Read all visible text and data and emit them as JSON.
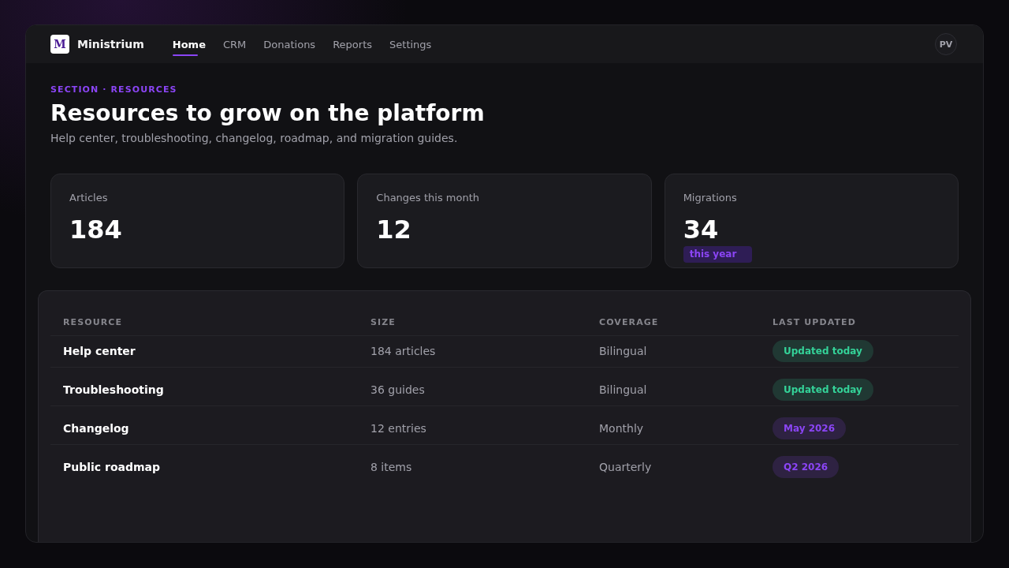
{
  "header": {
    "brand": {
      "logo_letter": "M",
      "name": "Ministrium"
    },
    "nav": [
      {
        "label": "Home",
        "selected": true
      },
      {
        "label": "CRM",
        "selected": false
      },
      {
        "label": "Donations",
        "selected": false
      },
      {
        "label": "Reports",
        "selected": false
      },
      {
        "label": "Settings",
        "selected": false
      }
    ],
    "avatar": "PV"
  },
  "hero": {
    "eyebrow": "SECTION · RESOURCES",
    "title": "Resources to grow on the platform",
    "subtitle": "Help center, troubleshooting, changelog, roadmap, and migration guides."
  },
  "stats": [
    {
      "label": "Articles",
      "value": "184"
    },
    {
      "label": "Changes this month",
      "value": "12"
    },
    {
      "label": "Migrations",
      "value": "34",
      "badge": "this year"
    }
  ],
  "table": {
    "columns": [
      "RESOURCE",
      "SIZE",
      "COVERAGE",
      "LAST UPDATED"
    ],
    "rows": [
      {
        "resource": "Help center",
        "size": "184 articles",
        "coverage": "Bilingual",
        "last_updated": {
          "text": "Updated today",
          "color": "#34d399"
        }
      },
      {
        "resource": "Troubleshooting",
        "size": "36 guides",
        "coverage": "Bilingual",
        "last_updated": {
          "text": "Updated today",
          "color": "#34d399"
        }
      },
      {
        "resource": "Changelog",
        "size": "12 entries",
        "coverage": "Monthly",
        "last_updated": {
          "text": "May 2026",
          "color": "#8b45f5"
        }
      },
      {
        "resource": "Public roadmap",
        "size": "8 items",
        "coverage": "Quarterly",
        "last_updated": {
          "text": "Q2 2026",
          "color": "#8b45f5"
        }
      }
    ]
  }
}
